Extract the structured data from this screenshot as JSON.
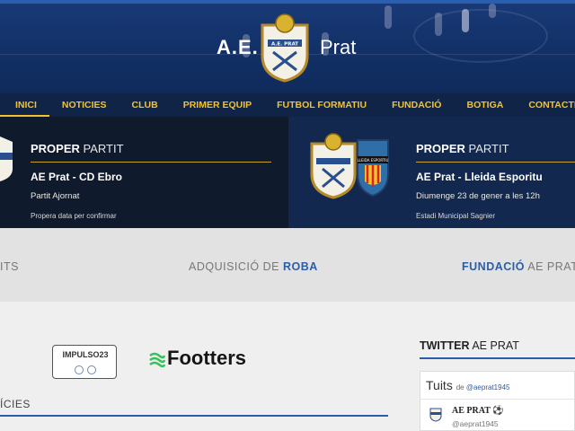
{
  "header": {
    "brand_left": "A.E.",
    "brand_right": "Prat",
    "crest_text": "A.E. PRAT"
  },
  "nav": {
    "items": [
      "INICI",
      "NOTICIES",
      "CLUB",
      "PRIMER EQUIP",
      "FUTBOL FORMATIU",
      "FUNDACIÓ",
      "BOTIGA",
      "CONTACTE"
    ],
    "active": "INICI"
  },
  "matches": [
    {
      "title_bold": "PROPER",
      "title_rest": "PARTIT",
      "teams": "AE Prat - CD Ebro",
      "date": "Partit Ajornat",
      "note": "Propera data per confirmar"
    },
    {
      "title_bold": "PROPER",
      "title_rest": "PARTIT",
      "teams": "AE Prat - Lleida Esporitu",
      "date": "Diumenge 23 de gener a les 12h",
      "note": "Estadi Municipal Sagnier",
      "away_badge_text": "LLEIDA ESPORTIU"
    }
  ],
  "links": {
    "left_partial": "ITS",
    "center_rest": "ADQUISICIÓ DE",
    "center_bold": "ROBA",
    "right_bold": "FUNDACIÓ",
    "right_rest": "AE PRAT"
  },
  "sponsors": {
    "impulso": "IMPULSO23",
    "footters": "Footters"
  },
  "news": {
    "heading": "ÍCIES"
  },
  "twitter": {
    "title_bold": "TWITTER",
    "title_rest": "AE PRAT",
    "tuits": "Tuits",
    "de": "de",
    "handle_link": "@aeprat1945",
    "name": "AE PRAT",
    "name_icon": "soccer-ball-icon",
    "handle": "@aeprat1945"
  },
  "colors": {
    "nav_bg": "#0f2446",
    "nav_text": "#f2c230",
    "accent_blue": "#2b5ea6",
    "banner_left": "#0f1a2c",
    "banner_right": "#13284e"
  }
}
